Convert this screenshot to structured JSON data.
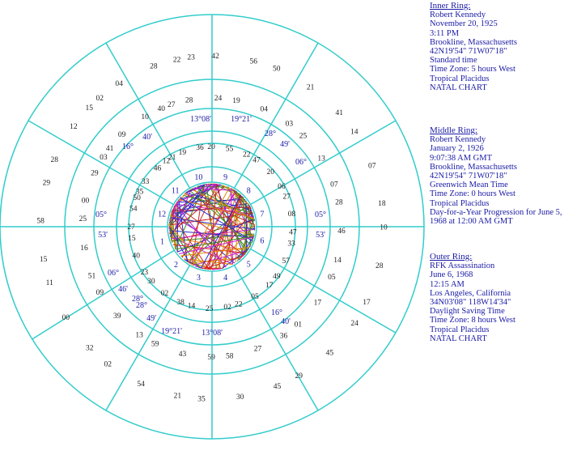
{
  "inner_ring": {
    "heading": "Inner Ring:",
    "lines": [
      "Robert Kennedy",
      "November 20, 1925",
      "3:11 PM",
      "Brookline, Massachusetts",
      "42N19'54\"  71W07'18\"",
      "Standard time",
      "Time Zone: 5 hours West",
      "Tropical Placidus",
      "NATAL CHART"
    ]
  },
  "middle_ring": {
    "heading": "Middle Ring:",
    "lines": [
      "Robert Kennedy",
      "January 2, 1926",
      "9:07:38 AM GMT",
      "Brookline, Massachusetts",
      "42N19'54\"  71W07'18\"",
      "Greenwich Mean Time",
      "Time Zone: 0 hours West",
      "Tropical Placidus",
      "Day-for-a-Year Progression  for June 5, 1968 at 12:00 AM GMT"
    ]
  },
  "outer_ring": {
    "heading": "Outer Ring:",
    "lines": [
      "RFK Assassination",
      "June 6, 1968",
      "12:15 AM",
      "Los Angeles, California",
      "34N03'08\"  118W14'34\"",
      "Daylight Saving Time",
      "Time Zone: 8 hours West",
      "Tropical Placidus",
      "NATAL CHART"
    ]
  },
  "colors": {
    "ring": "#33cccc",
    "text": "#1a1aa6",
    "fire": "#cc2222",
    "earth": "#3a8a1a",
    "air": "#8a6a1a",
    "water": "#2a2acc"
  },
  "house_numbers": [
    "1",
    "2",
    "3",
    "4",
    "5",
    "6",
    "7",
    "8",
    "9",
    "10",
    "11",
    "12"
  ],
  "cusp_labels": [
    {
      "text": "13°08'"
    },
    {
      "text": "19°21'"
    },
    {
      "text": "28°"
    },
    {
      "text": "49'"
    },
    {
      "text": "06°"
    },
    {
      "text": "05°"
    },
    {
      "text": "53'"
    },
    {
      "text": "16°"
    },
    {
      "text": "40'"
    },
    {
      "text": "28°"
    },
    {
      "text": "49'"
    },
    {
      "text": "19°21'"
    },
    {
      "text": "13°08'"
    },
    {
      "text": "06°"
    },
    {
      "text": "46'"
    },
    {
      "text": "05°"
    },
    {
      "text": "53'"
    },
    {
      "text": "16°"
    },
    {
      "text": "40'"
    },
    {
      "text": "28°"
    }
  ],
  "planet_labels": [
    {
      "text": "23"
    },
    {
      "text": "27"
    },
    {
      "text": "21"
    },
    {
      "text": "02"
    },
    {
      "text": "41"
    },
    {
      "text": "35"
    },
    {
      "text": "29"
    },
    {
      "text": "25"
    },
    {
      "text": "15"
    },
    {
      "text": "11"
    },
    {
      "text": "09"
    },
    {
      "text": "30"
    },
    {
      "text": "02"
    },
    {
      "text": "59"
    },
    {
      "text": "14"
    },
    {
      "text": "35"
    },
    {
      "text": "58"
    },
    {
      "text": "22"
    },
    {
      "text": "29"
    },
    {
      "text": "01"
    },
    {
      "text": "49"
    },
    {
      "text": "17"
    },
    {
      "text": "14"
    },
    {
      "text": "47"
    },
    {
      "text": "18"
    },
    {
      "text": "07"
    },
    {
      "text": "06"
    },
    {
      "text": "41"
    },
    {
      "text": "03"
    },
    {
      "text": "22"
    },
    {
      "text": "56"
    },
    {
      "text": "24"
    },
    {
      "text": "36"
    },
    {
      "text": "28"
    },
    {
      "text": "10"
    },
    {
      "text": "46"
    },
    {
      "text": "12"
    },
    {
      "text": "29"
    },
    {
      "text": "54"
    },
    {
      "text": "58"
    },
    {
      "text": "16"
    },
    {
      "text": "40"
    },
    {
      "text": "00"
    },
    {
      "text": "39"
    },
    {
      "text": "02"
    },
    {
      "text": "54"
    },
    {
      "text": "43"
    },
    {
      "text": "25"
    },
    {
      "text": "30"
    },
    {
      "text": "27"
    },
    {
      "text": "05"
    },
    {
      "text": "45"
    },
    {
      "text": "17"
    },
    {
      "text": "57"
    },
    {
      "text": "28"
    },
    {
      "text": "46"
    },
    {
      "text": "08"
    },
    {
      "text": "07"
    },
    {
      "text": "13"
    },
    {
      "text": "20"
    },
    {
      "text": "21"
    },
    {
      "text": "04"
    },
    {
      "text": "55"
    },
    {
      "text": "42"
    },
    {
      "text": "28"
    },
    {
      "text": "19"
    },
    {
      "text": "04"
    },
    {
      "text": "09"
    },
    {
      "text": "33"
    },
    {
      "text": "28"
    },
    {
      "text": "00"
    },
    {
      "text": "27"
    },
    {
      "text": "15"
    },
    {
      "text": "51"
    },
    {
      "text": "23"
    },
    {
      "text": "32"
    },
    {
      "text": "13"
    },
    {
      "text": "38"
    },
    {
      "text": "21"
    },
    {
      "text": "59"
    },
    {
      "text": "02"
    },
    {
      "text": "45"
    },
    {
      "text": "36"
    },
    {
      "text": "17"
    },
    {
      "text": "24"
    },
    {
      "text": "05"
    },
    {
      "text": "33"
    },
    {
      "text": "10"
    },
    {
      "text": "28"
    },
    {
      "text": "27"
    },
    {
      "text": "14"
    },
    {
      "text": "25"
    },
    {
      "text": "47"
    },
    {
      "text": "50"
    },
    {
      "text": "19"
    },
    {
      "text": "20"
    },
    {
      "text": "22"
    },
    {
      "text": "40"
    },
    {
      "text": "12"
    },
    {
      "text": "15"
    },
    {
      "text": "03"
    },
    {
      "text": "50"
    }
  ]
}
